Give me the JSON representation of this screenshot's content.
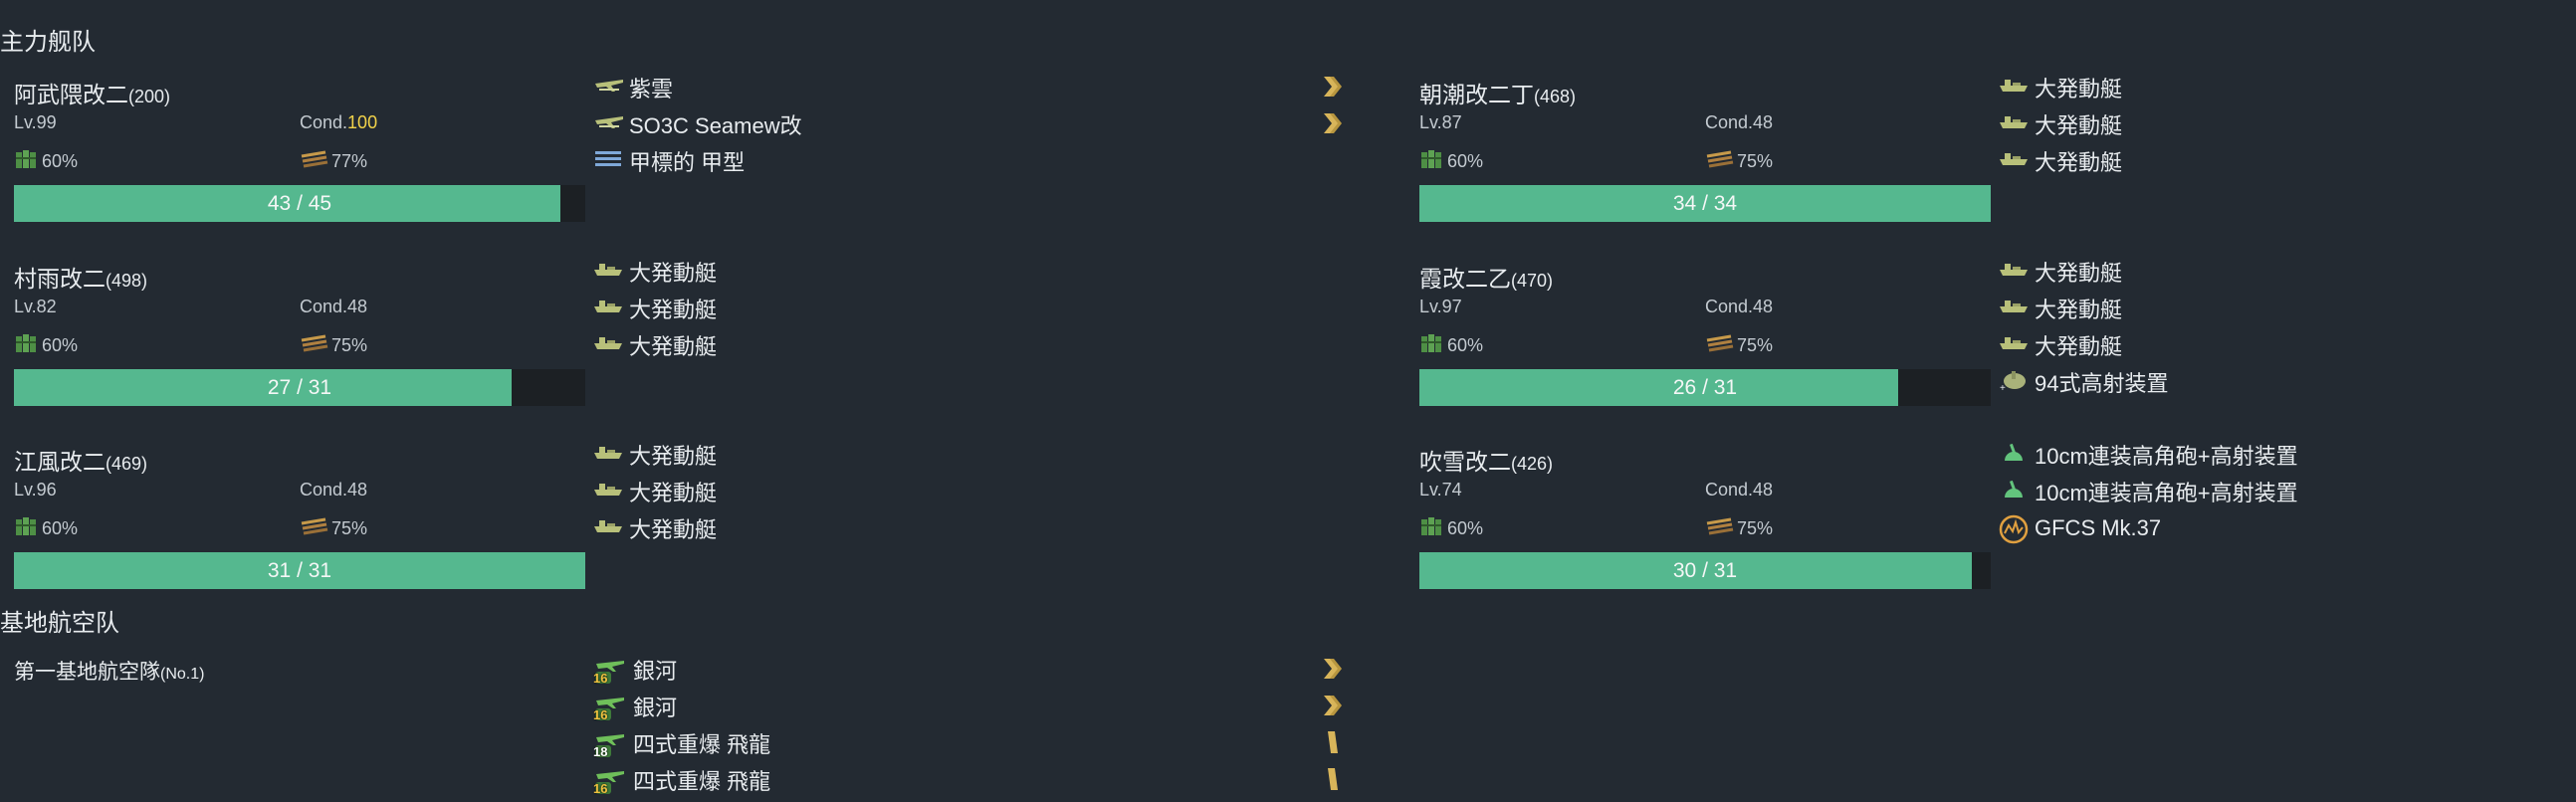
{
  "main_fleet": {
    "title": "主力舰队",
    "ships": [
      {
        "name": "阿武隈改二",
        "id": "(200)",
        "level": "Lv.99",
        "cond_label": "Cond.",
        "cond_value": "100",
        "cond_high": true,
        "fuel": "60%",
        "ammo": "77%",
        "hp": "43 / 45",
        "hp_fraction": 0.9556,
        "equipment": [
          {
            "name": "紫雲",
            "icon": "seaplane-icon",
            "prof": true
          },
          {
            "name": "SO3C Seamew改",
            "icon": "seaplane-icon",
            "prof": true
          },
          {
            "name": "甲標的 甲型",
            "icon": "midget-sub-icon",
            "prof": false
          }
        ]
      },
      {
        "name": "村雨改二",
        "id": "(498)",
        "level": "Lv.82",
        "cond_label": "Cond.",
        "cond_value": "48",
        "cond_high": false,
        "fuel": "60%",
        "ammo": "75%",
        "hp": "27 / 31",
        "hp_fraction": 0.871,
        "equipment": [
          {
            "name": "大発動艇",
            "icon": "landing-craft-icon"
          },
          {
            "name": "大発動艇",
            "icon": "landing-craft-icon"
          },
          {
            "name": "大発動艇",
            "icon": "landing-craft-icon"
          }
        ]
      },
      {
        "name": "江風改二",
        "id": "(469)",
        "level": "Lv.96",
        "cond_label": "Cond.",
        "cond_value": "48",
        "cond_high": false,
        "fuel": "60%",
        "ammo": "75%",
        "hp": "31 / 31",
        "hp_fraction": 1.0,
        "equipment": [
          {
            "name": "大発動艇",
            "icon": "landing-craft-icon"
          },
          {
            "name": "大発動艇",
            "icon": "landing-craft-icon"
          },
          {
            "name": "大発動艇",
            "icon": "landing-craft-icon"
          }
        ]
      },
      {
        "name": "朝潮改二丁",
        "id": "(468)",
        "level": "Lv.87",
        "cond_label": "Cond.",
        "cond_value": "48",
        "cond_high": false,
        "fuel": "60%",
        "ammo": "75%",
        "hp": "34 / 34",
        "hp_fraction": 1.0,
        "equipment": [
          {
            "name": "大発動艇",
            "icon": "landing-craft-icon"
          },
          {
            "name": "大発動艇",
            "icon": "landing-craft-icon"
          },
          {
            "name": "大発動艇",
            "icon": "landing-craft-icon"
          }
        ]
      },
      {
        "name": "霞改二乙",
        "id": "(470)",
        "level": "Lv.97",
        "cond_label": "Cond.",
        "cond_value": "48",
        "cond_high": false,
        "fuel": "60%",
        "ammo": "75%",
        "hp": "26 / 31",
        "hp_fraction": 0.8387,
        "equipment": [
          {
            "name": "大発動艇",
            "icon": "landing-craft-icon"
          },
          {
            "name": "大発動艇",
            "icon": "landing-craft-icon"
          },
          {
            "name": "大発動艇",
            "icon": "landing-craft-icon"
          },
          {
            "name": "94式高射装置",
            "icon": "aa-director-icon"
          }
        ]
      },
      {
        "name": "吹雪改二",
        "id": "(426)",
        "level": "Lv.74",
        "cond_label": "Cond.",
        "cond_value": "48",
        "cond_high": false,
        "fuel": "60%",
        "ammo": "75%",
        "hp": "30 / 31",
        "hp_fraction": 0.9677,
        "equipment": [
          {
            "name": "10cm連装高角砲+高射装置",
            "icon": "high-angle-gun-icon"
          },
          {
            "name": "10cm連装高角砲+高射装置",
            "icon": "high-angle-gun-icon"
          },
          {
            "name": "GFCS Mk.37",
            "icon": "radar-icon"
          }
        ]
      }
    ]
  },
  "land_base": {
    "title": "基地航空队",
    "name": "第一基地航空隊",
    "id": "(No.1)",
    "equipment": [
      {
        "name": "銀河",
        "icon": "land-bomber-icon",
        "count": "16",
        "prof": "double"
      },
      {
        "name": "銀河",
        "icon": "land-bomber-icon",
        "count": "16",
        "prof": "double"
      },
      {
        "name": "四式重爆 飛龍",
        "icon": "land-bomber-icon",
        "count": "18",
        "prof": "single"
      },
      {
        "name": "四式重爆 飛龍",
        "icon": "land-bomber-icon",
        "count": "16",
        "prof": "single"
      }
    ]
  },
  "colors": {
    "background": "#232a32",
    "hp_fill": "#55b88f",
    "hp_track": "#1c2024",
    "cond_high": "#f2d34a",
    "proficiency": "#d8b55a",
    "icon_olive": "#b8c07a"
  }
}
